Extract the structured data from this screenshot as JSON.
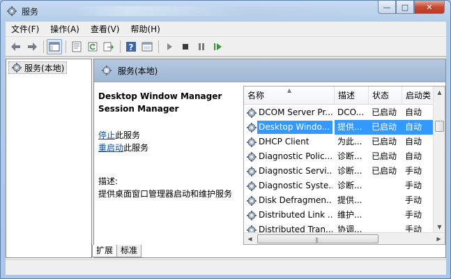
{
  "window": {
    "title": "服务"
  },
  "menu": [
    "文件(F)",
    "操作(A)",
    "查看(V)",
    "帮助(H)"
  ],
  "tree": {
    "root_label": "服务(本地)"
  },
  "pane": {
    "header": "服务(本地)"
  },
  "detail": {
    "service_name_line1": "Desktop Window Manager",
    "service_name_line2": "Session Manager",
    "stop_link": "停止",
    "stop_suffix": "此服务",
    "restart_link": "重启动",
    "restart_suffix": "此服务",
    "desc_label": "描述:",
    "desc_text": "提供桌面窗口管理器启动和维护服务"
  },
  "list": {
    "columns": [
      "名称",
      "描述",
      "状态",
      "启动类"
    ],
    "rows": [
      {
        "name": "DCOM Server Pr...",
        "desc": "DCO...",
        "status": "已启动",
        "start": "自动",
        "selected": false
      },
      {
        "name": "Desktop Windo...",
        "desc": "提供...",
        "status": "已启动",
        "start": "自动",
        "selected": true
      },
      {
        "name": "DHCP Client",
        "desc": "为此...",
        "status": "已启动",
        "start": "自动",
        "selected": false
      },
      {
        "name": "Diagnostic Polic...",
        "desc": "诊断...",
        "status": "已启动",
        "start": "自动",
        "selected": false
      },
      {
        "name": "Diagnostic Servi...",
        "desc": "诊断...",
        "status": "已启动",
        "start": "手动",
        "selected": false
      },
      {
        "name": "Diagnostic Syste...",
        "desc": "诊断...",
        "status": "",
        "start": "手动",
        "selected": false
      },
      {
        "name": "Disk Defragmen...",
        "desc": "提供...",
        "status": "",
        "start": "手动",
        "selected": false
      },
      {
        "name": "Distributed Link ...",
        "desc": "维护...",
        "status": "",
        "start": "手动",
        "selected": false
      },
      {
        "name": "Distributed Tran...",
        "desc": "协调...",
        "status": "",
        "start": "手动",
        "selected": false
      }
    ]
  },
  "tabs": [
    "扩展",
    "标准"
  ],
  "colors": {
    "selection": "#3399ff",
    "link": "#0b4ea2",
    "pane_header": "#a9bfd9"
  },
  "icons": [
    "services-app-icon",
    "back-arrow-icon",
    "forward-arrow-icon",
    "console-tree-icon",
    "properties-icon",
    "refresh-icon",
    "export-icon",
    "help-icon",
    "view-icon",
    "start-icon",
    "stop-icon",
    "pause-icon",
    "resume-icon",
    "gear-icon"
  ]
}
